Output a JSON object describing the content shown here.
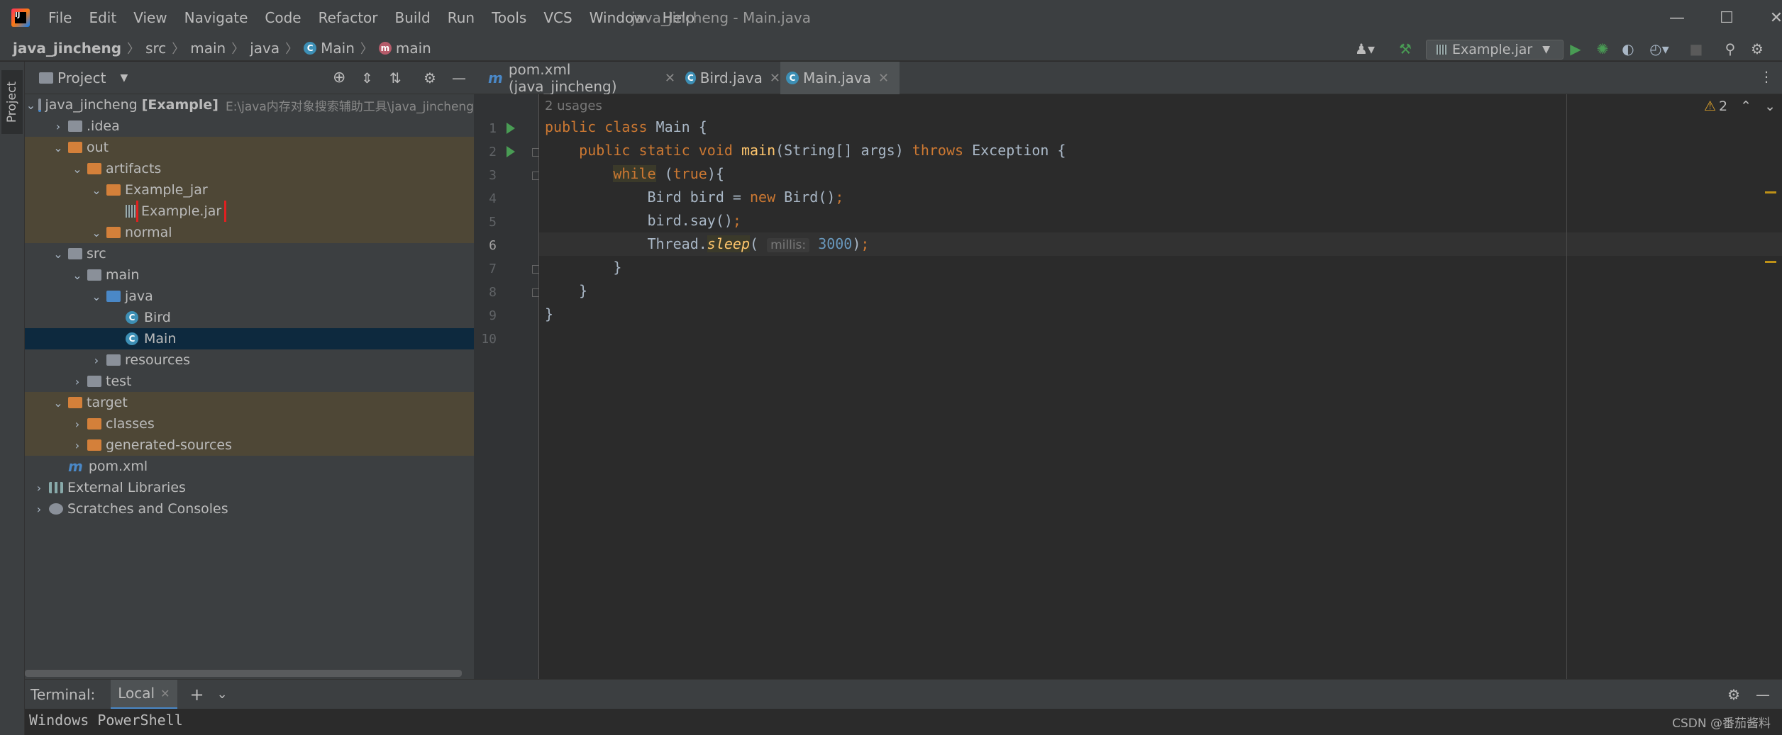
{
  "titlebar": {
    "menu": [
      "File",
      "Edit",
      "View",
      "Navigate",
      "Code",
      "Refactor",
      "Build",
      "Run",
      "Tools",
      "VCS",
      "Window",
      "Help"
    ],
    "window_title": "java_jincheng - Main.java"
  },
  "navbar": {
    "crumbs": [
      {
        "label": "java_jincheng",
        "icon": ""
      },
      {
        "label": "src",
        "icon": ""
      },
      {
        "label": "main",
        "icon": ""
      },
      {
        "label": "java",
        "icon": ""
      },
      {
        "label": "Main",
        "icon": "class-icon"
      },
      {
        "label": "main",
        "icon": "method-icon"
      }
    ],
    "run_config": "Example.jar"
  },
  "left_stripe": {
    "project_label": "Project"
  },
  "project_panel": {
    "title": "Project",
    "tree": [
      {
        "depth": 0,
        "arrow": "v",
        "icon": "module",
        "label": "java_jincheng [Example]",
        "hint": "E:\\java内存对象搜索辅助工具\\java_jincheng",
        "style": ""
      },
      {
        "depth": 1,
        "arrow": ">",
        "icon": "folder-gray",
        "label": ".idea",
        "style": ""
      },
      {
        "depth": 1,
        "arrow": "v",
        "icon": "folder-orange",
        "label": "out",
        "style": "excl"
      },
      {
        "depth": 2,
        "arrow": "v",
        "icon": "folder-orange",
        "label": "artifacts",
        "style": "excl"
      },
      {
        "depth": 3,
        "arrow": "v",
        "icon": "folder-orange",
        "label": "Example_jar",
        "style": "excl"
      },
      {
        "depth": 4,
        "arrow": "",
        "icon": "jar",
        "label": "Example.jar",
        "style": "excl",
        "highlight": true
      },
      {
        "depth": 3,
        "arrow": "v",
        "icon": "folder-orange",
        "label": "normal",
        "style": "excl"
      },
      {
        "depth": 1,
        "arrow": "v",
        "icon": "folder-gray",
        "label": "src",
        "style": ""
      },
      {
        "depth": 2,
        "arrow": "v",
        "icon": "folder-gray",
        "label": "main",
        "style": ""
      },
      {
        "depth": 3,
        "arrow": "v",
        "icon": "folder-blue",
        "label": "java",
        "style": ""
      },
      {
        "depth": 4,
        "arrow": "",
        "icon": "class",
        "label": "Bird",
        "style": ""
      },
      {
        "depth": 4,
        "arrow": "",
        "icon": "class",
        "label": "Main",
        "style": "sel"
      },
      {
        "depth": 3,
        "arrow": ">",
        "icon": "folder-gray",
        "label": "resources",
        "style": ""
      },
      {
        "depth": 2,
        "arrow": ">",
        "icon": "folder-gray",
        "label": "test",
        "style": ""
      },
      {
        "depth": 1,
        "arrow": "v",
        "icon": "folder-orange",
        "label": "target",
        "style": "excl"
      },
      {
        "depth": 2,
        "arrow": ">",
        "icon": "folder-orange",
        "label": "classes",
        "style": "excl"
      },
      {
        "depth": 2,
        "arrow": ">",
        "icon": "folder-orange",
        "label": "generated-sources",
        "style": "excl"
      },
      {
        "depth": 1,
        "arrow": "",
        "icon": "maven",
        "label": "pom.xml",
        "style": ""
      },
      {
        "depth": 0,
        "arrow": ">",
        "icon": "libs",
        "label": "External Libraries",
        "style": ""
      },
      {
        "depth": 0,
        "arrow": ">",
        "icon": "scratch",
        "label": "Scratches and Consoles",
        "style": ""
      }
    ]
  },
  "tabs": [
    {
      "label": "pom.xml (java_jincheng)",
      "icon": "maven-icon",
      "active": false
    },
    {
      "label": "Bird.java",
      "icon": "class-icon",
      "active": false
    },
    {
      "label": "Main.java",
      "icon": "class-icon",
      "active": true
    }
  ],
  "editor": {
    "usages": "2 usages",
    "warning_count": "2",
    "line_numbers": [
      "1",
      "2",
      "3",
      "4",
      "5",
      "6",
      "7",
      "8",
      "9",
      "10"
    ],
    "hint_millis": "millis:"
  },
  "terminal": {
    "label": "Terminal:",
    "tab": "Local",
    "output": "Windows PowerShell"
  },
  "watermark": "CSDN @番茄酱料"
}
